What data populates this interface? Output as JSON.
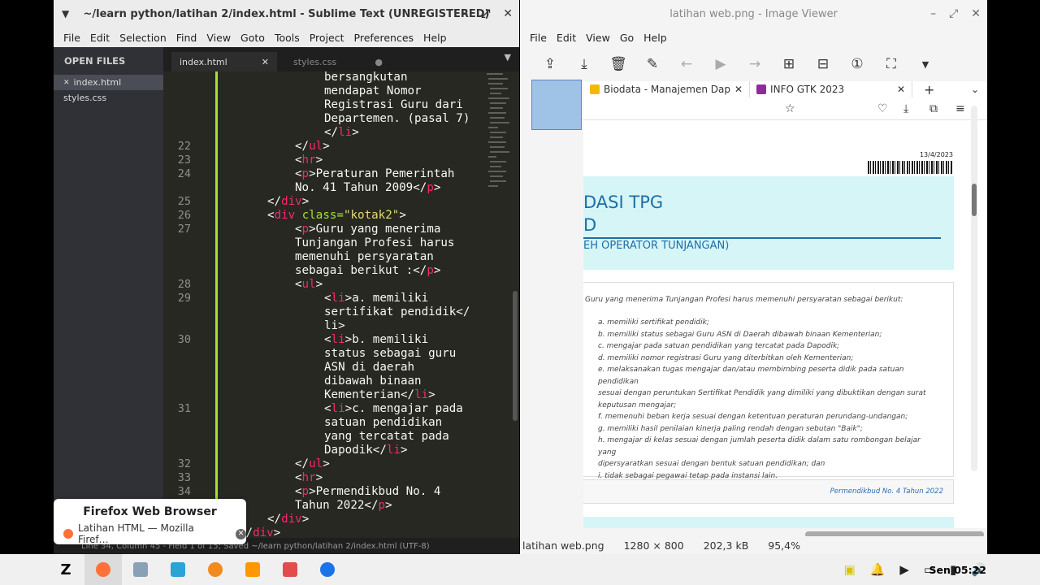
{
  "sublime": {
    "title": "~/learn python/latihan 2/index.html - Sublime Text (UNREGISTERED)",
    "menu": [
      "File",
      "Edit",
      "Selection",
      "Find",
      "View",
      "Goto",
      "Tools",
      "Project",
      "Preferences",
      "Help"
    ],
    "sidebar_header": "OPEN FILES",
    "files": [
      "index.html",
      "styles.css"
    ],
    "tabs": [
      "index.html",
      "styles.css"
    ],
    "status": "Line 34, Column 45 - Field 1 of 15; Saved ~/learn python/latihan 2/index.html (UTF-8)"
  },
  "tooltip": {
    "title": "Firefox Web Browser",
    "item": "Latihan HTML — Mozilla Firef…"
  },
  "viewer": {
    "title": "latihan web.png - Image Viewer",
    "menu": [
      "File",
      "Edit",
      "View",
      "Go",
      "Help"
    ],
    "filename": "latihan web.png",
    "dimensions": "1280 × 800",
    "size": "202,3 kB",
    "zoom": "95,4%"
  },
  "ff": {
    "tab1": "Biodata - Manajemen Dap",
    "tab2": "INFO GTK 2023"
  },
  "doc": {
    "date": "13/4/2023",
    "head1": "DASI TPG",
    "head2": "D",
    "subhead": "EH OPERATOR TUNJANGAN)",
    "intro": "Guru yang menerima Tunjangan Profesi harus memenuhi persyaratan sebagai berikut:",
    "items": [
      "a.  memiliki sertifikat pendidik;",
      "b.  memiliki status sebagai Guru ASN di Daerah dibawah binaan Kementerian;",
      "c.  mengajar pada satuan pendidikan yang tercatat pada Dapodik;",
      "d.  memiliki nomor registrasi Guru yang diterbitkan oleh Kementerian;",
      "e.  melaksanakan tugas mengajar dan/atau membimbing peserta didik pada satuan pendidikan",
      "      sesuai dengan peruntukan Sertifikat Pendidik yang dimiliki yang dibuktikan dengan surat",
      "      keputusan mengajar;",
      "f.  memenuhi beban kerja sesuai dengan ketentuan peraturan perundang-undangan;",
      "g.  memiliki hasil penilaian kinerja paling rendah dengan sebutan \"Baik\";",
      "h.  mengajar di kelas sesuai dengan jumlah peserta didik dalam satu rombongan belajar yang",
      "      dipersyaratkan sesuai dengan bentuk satuan pendidikan; dan",
      "i.  tidak sebagai pegawai tetap pada instansi lain."
    ],
    "footer": "Permendikbud No. 4 Tahun 2022"
  },
  "taskbar": {
    "clock": "Sen 05:22"
  },
  "code": [
    {
      "n": "",
      "t": "bersangkutan"
    },
    {
      "n": "",
      "t": "mendapat Nomor"
    },
    {
      "n": "",
      "t": "Registrasi Guru dari"
    },
    {
      "n": "",
      "t": "Departemen. (pasal 7)"
    },
    {
      "n": "",
      "t": "</li>"
    },
    {
      "n": "22",
      "t": "</ul>"
    },
    {
      "n": "23",
      "t": "<hr>"
    },
    {
      "n": "24",
      "t": "<p>Peraturan Pemerintah"
    },
    {
      "n": "",
      "t": "No. 41 Tahun 2009</p>"
    },
    {
      "n": "25",
      "t": "</div>"
    },
    {
      "n": "26",
      "t": "<div class=\"kotak2\">"
    },
    {
      "n": "27",
      "t": "<p>Guru yang menerima"
    },
    {
      "n": "",
      "t": "Tunjangan Profesi harus"
    },
    {
      "n": "",
      "t": "memenuhi persyaratan"
    },
    {
      "n": "",
      "t": "sebagai berikut :</p>"
    },
    {
      "n": "28",
      "t": "<ul>"
    },
    {
      "n": "29",
      "t": "<li>a. memiliki"
    },
    {
      "n": "",
      "t": "sertifikat pendidik</"
    },
    {
      "n": "",
      "t": "li>"
    },
    {
      "n": "30",
      "t": "<li>b. memiliki"
    },
    {
      "n": "",
      "t": "status sebagai guru"
    },
    {
      "n": "",
      "t": "ASN di daerah"
    },
    {
      "n": "",
      "t": "dibawah binaan"
    },
    {
      "n": "",
      "t": "Kementerian</li>"
    },
    {
      "n": "31",
      "t": "<li>c. mengajar pada"
    },
    {
      "n": "",
      "t": "satuan pendidikan"
    },
    {
      "n": "",
      "t": "yang tercatat pada"
    },
    {
      "n": "",
      "t": "Dapodik</li>"
    },
    {
      "n": "32",
      "t": "</ul>"
    },
    {
      "n": "33",
      "t": "<hr>"
    },
    {
      "n": "34",
      "t": "<p>Permendikbud No. 4"
    },
    {
      "n": "",
      "t": "Tahun 2022</p>"
    },
    {
      "n": "35",
      "t": "</div>"
    },
    {
      "n": "36",
      "t": "</div>"
    }
  ]
}
